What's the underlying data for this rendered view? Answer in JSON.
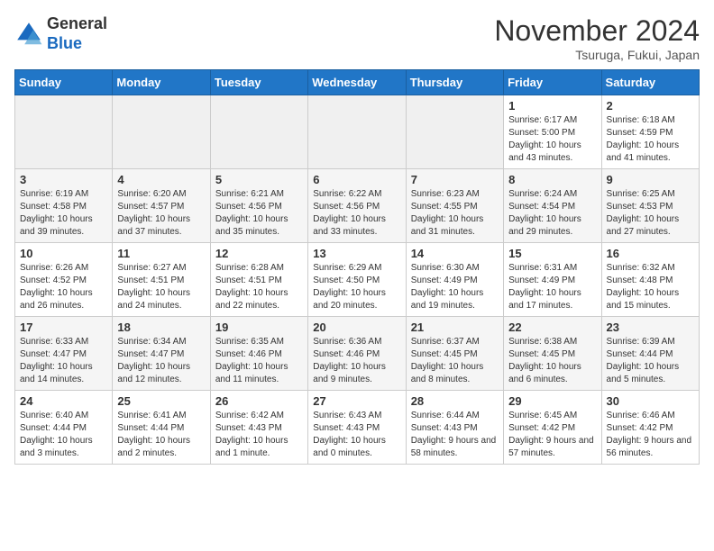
{
  "header": {
    "logo_general": "General",
    "logo_blue": "Blue",
    "month_title": "November 2024",
    "subtitle": "Tsuruga, Fukui, Japan"
  },
  "weekdays": [
    "Sunday",
    "Monday",
    "Tuesday",
    "Wednesday",
    "Thursday",
    "Friday",
    "Saturday"
  ],
  "weeks": [
    [
      {
        "day": "",
        "info": ""
      },
      {
        "day": "",
        "info": ""
      },
      {
        "day": "",
        "info": ""
      },
      {
        "day": "",
        "info": ""
      },
      {
        "day": "",
        "info": ""
      },
      {
        "day": "1",
        "info": "Sunrise: 6:17 AM\nSunset: 5:00 PM\nDaylight: 10 hours and 43 minutes."
      },
      {
        "day": "2",
        "info": "Sunrise: 6:18 AM\nSunset: 4:59 PM\nDaylight: 10 hours and 41 minutes."
      }
    ],
    [
      {
        "day": "3",
        "info": "Sunrise: 6:19 AM\nSunset: 4:58 PM\nDaylight: 10 hours and 39 minutes."
      },
      {
        "day": "4",
        "info": "Sunrise: 6:20 AM\nSunset: 4:57 PM\nDaylight: 10 hours and 37 minutes."
      },
      {
        "day": "5",
        "info": "Sunrise: 6:21 AM\nSunset: 4:56 PM\nDaylight: 10 hours and 35 minutes."
      },
      {
        "day": "6",
        "info": "Sunrise: 6:22 AM\nSunset: 4:56 PM\nDaylight: 10 hours and 33 minutes."
      },
      {
        "day": "7",
        "info": "Sunrise: 6:23 AM\nSunset: 4:55 PM\nDaylight: 10 hours and 31 minutes."
      },
      {
        "day": "8",
        "info": "Sunrise: 6:24 AM\nSunset: 4:54 PM\nDaylight: 10 hours and 29 minutes."
      },
      {
        "day": "9",
        "info": "Sunrise: 6:25 AM\nSunset: 4:53 PM\nDaylight: 10 hours and 27 minutes."
      }
    ],
    [
      {
        "day": "10",
        "info": "Sunrise: 6:26 AM\nSunset: 4:52 PM\nDaylight: 10 hours and 26 minutes."
      },
      {
        "day": "11",
        "info": "Sunrise: 6:27 AM\nSunset: 4:51 PM\nDaylight: 10 hours and 24 minutes."
      },
      {
        "day": "12",
        "info": "Sunrise: 6:28 AM\nSunset: 4:51 PM\nDaylight: 10 hours and 22 minutes."
      },
      {
        "day": "13",
        "info": "Sunrise: 6:29 AM\nSunset: 4:50 PM\nDaylight: 10 hours and 20 minutes."
      },
      {
        "day": "14",
        "info": "Sunrise: 6:30 AM\nSunset: 4:49 PM\nDaylight: 10 hours and 19 minutes."
      },
      {
        "day": "15",
        "info": "Sunrise: 6:31 AM\nSunset: 4:49 PM\nDaylight: 10 hours and 17 minutes."
      },
      {
        "day": "16",
        "info": "Sunrise: 6:32 AM\nSunset: 4:48 PM\nDaylight: 10 hours and 15 minutes."
      }
    ],
    [
      {
        "day": "17",
        "info": "Sunrise: 6:33 AM\nSunset: 4:47 PM\nDaylight: 10 hours and 14 minutes."
      },
      {
        "day": "18",
        "info": "Sunrise: 6:34 AM\nSunset: 4:47 PM\nDaylight: 10 hours and 12 minutes."
      },
      {
        "day": "19",
        "info": "Sunrise: 6:35 AM\nSunset: 4:46 PM\nDaylight: 10 hours and 11 minutes."
      },
      {
        "day": "20",
        "info": "Sunrise: 6:36 AM\nSunset: 4:46 PM\nDaylight: 10 hours and 9 minutes."
      },
      {
        "day": "21",
        "info": "Sunrise: 6:37 AM\nSunset: 4:45 PM\nDaylight: 10 hours and 8 minutes."
      },
      {
        "day": "22",
        "info": "Sunrise: 6:38 AM\nSunset: 4:45 PM\nDaylight: 10 hours and 6 minutes."
      },
      {
        "day": "23",
        "info": "Sunrise: 6:39 AM\nSunset: 4:44 PM\nDaylight: 10 hours and 5 minutes."
      }
    ],
    [
      {
        "day": "24",
        "info": "Sunrise: 6:40 AM\nSunset: 4:44 PM\nDaylight: 10 hours and 3 minutes."
      },
      {
        "day": "25",
        "info": "Sunrise: 6:41 AM\nSunset: 4:44 PM\nDaylight: 10 hours and 2 minutes."
      },
      {
        "day": "26",
        "info": "Sunrise: 6:42 AM\nSunset: 4:43 PM\nDaylight: 10 hours and 1 minute."
      },
      {
        "day": "27",
        "info": "Sunrise: 6:43 AM\nSunset: 4:43 PM\nDaylight: 10 hours and 0 minutes."
      },
      {
        "day": "28",
        "info": "Sunrise: 6:44 AM\nSunset: 4:43 PM\nDaylight: 9 hours and 58 minutes."
      },
      {
        "day": "29",
        "info": "Sunrise: 6:45 AM\nSunset: 4:42 PM\nDaylight: 9 hours and 57 minutes."
      },
      {
        "day": "30",
        "info": "Sunrise: 6:46 AM\nSunset: 4:42 PM\nDaylight: 9 hours and 56 minutes."
      }
    ]
  ]
}
